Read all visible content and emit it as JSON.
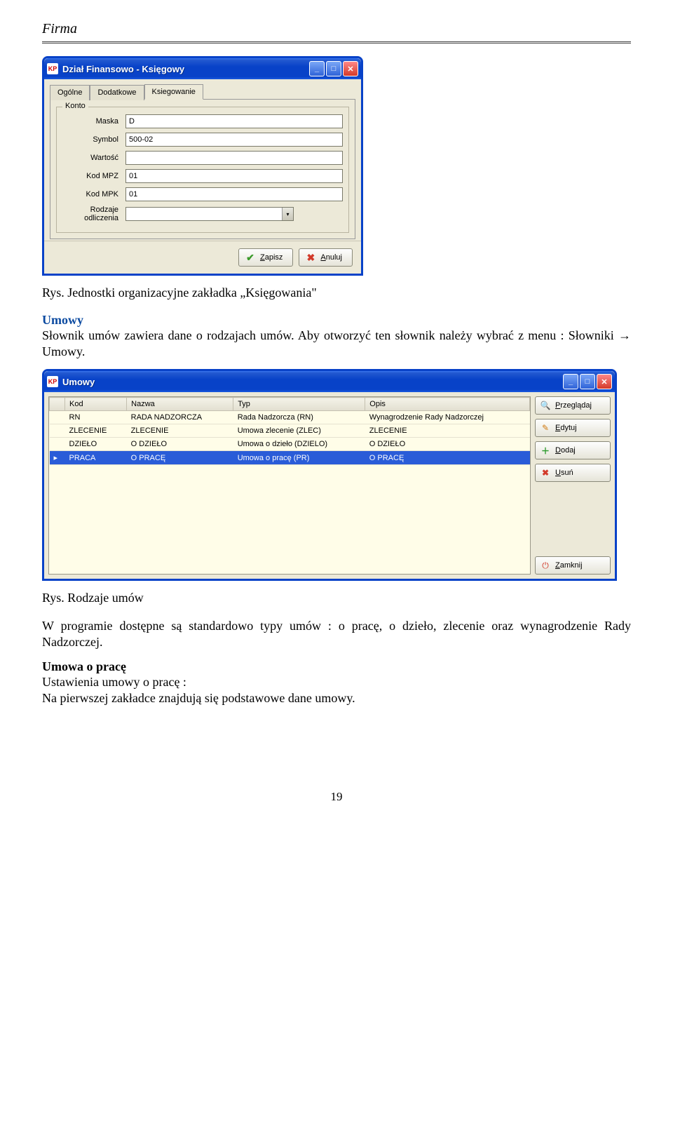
{
  "page": {
    "header_title": "Firma",
    "page_number": "19"
  },
  "window1": {
    "icon_text": "KP",
    "title": "Dział Finansowo - Księgowy",
    "tabs": {
      "t0": "Ogólne",
      "t1": "Dodatkowe",
      "t2": "Ksiegowanie"
    },
    "fieldset_label": "Konto",
    "labels": {
      "maska": "Maska",
      "symbol": "Symbol",
      "wartosc": "Wartość",
      "kodmpz": "Kod MPZ",
      "kodmpk": "Kod MPK",
      "rodzaje": "Rodzaje odliczenia"
    },
    "values": {
      "maska": "D",
      "symbol": "500-02",
      "wartosc": "",
      "kodmpz": "01",
      "kodmpk": "01",
      "rodzaje": ""
    },
    "buttons": {
      "save": "Zapisz",
      "cancel": "Anuluj"
    }
  },
  "caption1": "Rys. Jednostki organizacyjne zakładka „Księgowania\"",
  "section_umowy": {
    "title": "Umowy",
    "body": "Słownik umów zawiera dane o rodzajach umów. Aby otworzyć ten słownik należy wybrać z menu : Słowniki → Umowy."
  },
  "window2": {
    "icon_text": "KP",
    "title": "Umowy",
    "columns": {
      "c0": "Kod",
      "c1": "Nazwa",
      "c2": "Typ",
      "c3": "Opis"
    },
    "rows": [
      {
        "kod": "RN",
        "nazwa": "RADA NADZORCZA",
        "typ": "Rada Nadzorcza (RN)",
        "opis": "Wynagrodzenie Rady Nadzorczej",
        "sel": false
      },
      {
        "kod": "ZLECENIE",
        "nazwa": "ZLECENIE",
        "typ": "Umowa zlecenie (ZLEC)",
        "opis": "ZLECENIE",
        "sel": false
      },
      {
        "kod": "DZIEŁO",
        "nazwa": "O DZIEŁO",
        "typ": "Umowa o dzieło (DZIELO)",
        "opis": "O DZIEŁO",
        "sel": false
      },
      {
        "kod": "PRACA",
        "nazwa": "O PRACĘ",
        "typ": "Umowa o pracę (PR)",
        "opis": "O PRACĘ",
        "sel": true
      }
    ],
    "buttons": {
      "browse": "Przeglądaj",
      "edit": "Edytuj",
      "add": "Dodaj",
      "del": "Usuń",
      "close": "Zamknij"
    }
  },
  "caption2": "Rys. Rodzaje umów",
  "para2": "W programie dostępne są standardowo typy umów : o pracę, o dzieło, zlecenie oraz wynagrodzenie Rady Nadzorczej.",
  "section_uop": {
    "title": "Umowa o pracę",
    "body": "Ustawienia umowy o pracę :\nNa pierwszej zakładce znajdują się podstawowe dane umowy."
  }
}
